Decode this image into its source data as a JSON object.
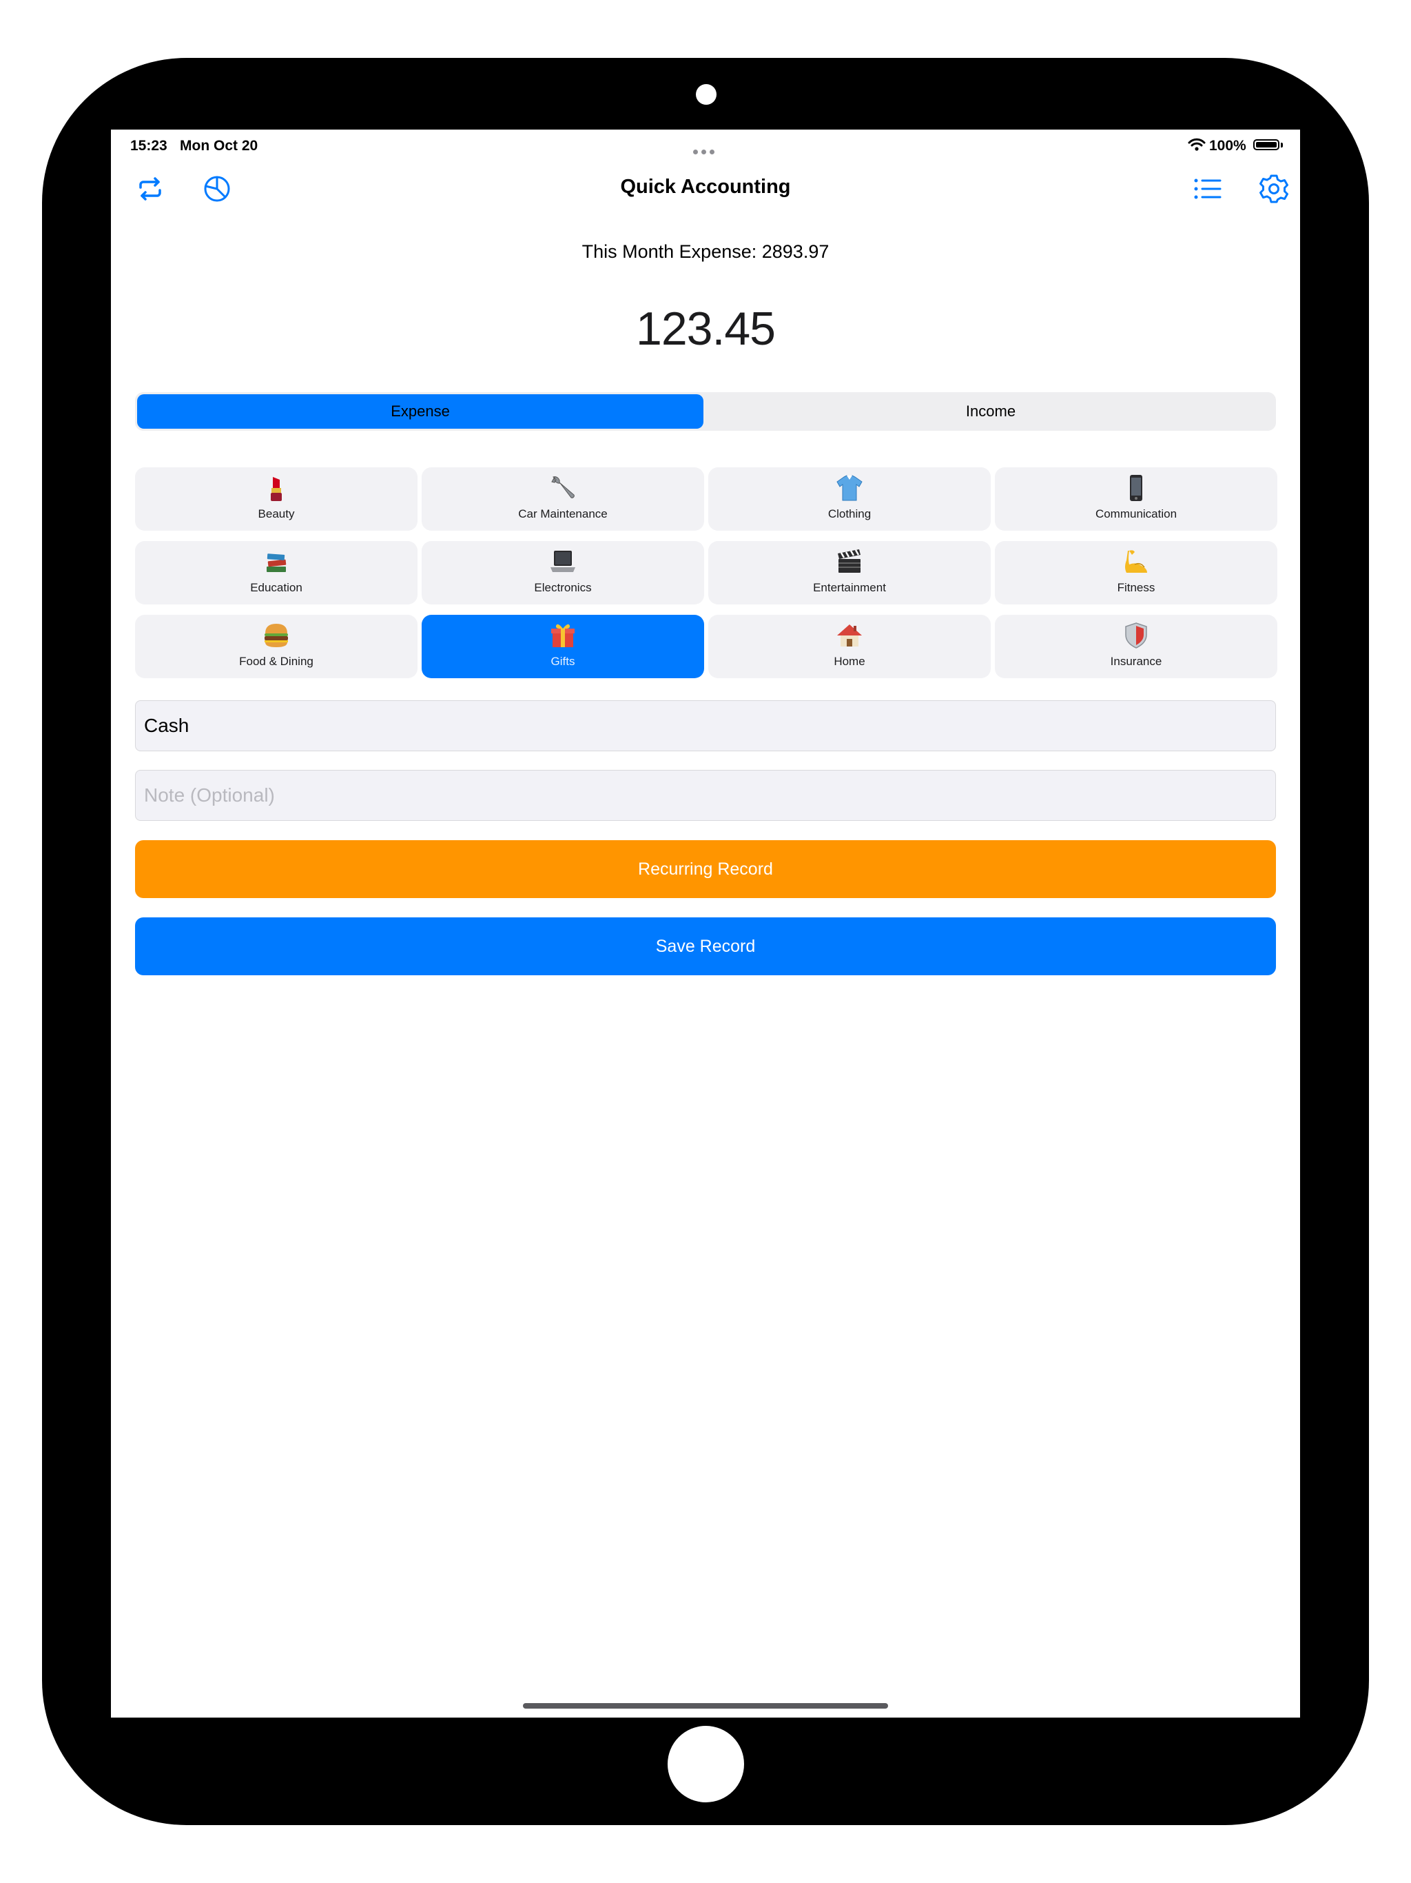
{
  "status_bar": {
    "time": "15:23",
    "date": "Mon Oct 20",
    "battery": "100%"
  },
  "nav": {
    "title": "Quick Accounting",
    "icons": [
      "repeat-icon",
      "pie-chart-icon",
      "list-icon",
      "gear-icon"
    ],
    "accent": "#007aff"
  },
  "summary": {
    "month_expense": "This Month Expense: 2893.97",
    "amount": "123.45"
  },
  "segment": {
    "options": [
      "Expense",
      "Income"
    ],
    "selected": "Expense"
  },
  "categories": [
    {
      "label": "Beauty",
      "icon": "lipstick-icon"
    },
    {
      "label": "Car Maintenance",
      "icon": "wrench-icon"
    },
    {
      "label": "Clothing",
      "icon": "shirt-icon"
    },
    {
      "label": "Communication",
      "icon": "phone-icon"
    },
    {
      "label": "Education",
      "icon": "books-icon"
    },
    {
      "label": "Electronics",
      "icon": "laptop-icon"
    },
    {
      "label": "Entertainment",
      "icon": "clapper-icon"
    },
    {
      "label": "Fitness",
      "icon": "biceps-icon"
    },
    {
      "label": "Food & Dining",
      "icon": "burger-icon"
    },
    {
      "label": "Gifts",
      "icon": "gift-icon"
    },
    {
      "label": "Home",
      "icon": "house-icon"
    },
    {
      "label": "Insurance",
      "icon": "shield-icon"
    }
  ],
  "selected_category": "Gifts",
  "form": {
    "account_value": "Cash",
    "note_placeholder": "Note (Optional)"
  },
  "buttons": {
    "recurring": "Recurring Record",
    "save": "Save Record"
  },
  "colors": {
    "blue": "#007aff",
    "orange": "#ff9500"
  }
}
